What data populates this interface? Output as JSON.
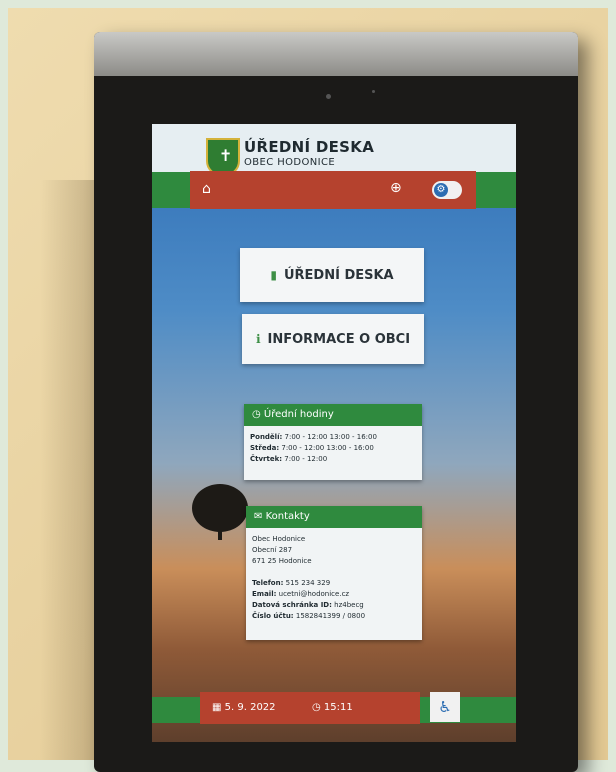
{
  "header": {
    "title": "ÚŘEDNÍ DESKA",
    "subtitle": "OBEC HODONICE"
  },
  "nav": {
    "home_icon": "home-icon",
    "zoom_icon": "zoom-icon",
    "settings_icon": "gear-icon"
  },
  "buttons": {
    "uredni_deska": "ÚŘEDNÍ DESKA",
    "informace": "INFORMACE O OBCI"
  },
  "hours": {
    "title": "Úřední hodiny",
    "rows": [
      {
        "day": "Pondělí:",
        "time": "7:00 - 12:00 13:00 - 16:00"
      },
      {
        "day": "Středa:",
        "time": "7:00 - 12:00 13:00 - 16:00"
      },
      {
        "day": "Čtvrtek:",
        "time": "7:00 - 12:00"
      }
    ]
  },
  "contacts": {
    "title": "Kontakty",
    "address": [
      "Obec Hodonice",
      "Obecní 287",
      "671 25 Hodonice"
    ],
    "rows": [
      {
        "label": "Telefon:",
        "value": "515 234 329"
      },
      {
        "label": "Email:",
        "value": "ucetni@hodonice.cz"
      },
      {
        "label": "Datová schránka ID:",
        "value": "hz4becg"
      },
      {
        "label": "Číslo účtu:",
        "value": "1582841399 / 0800"
      }
    ]
  },
  "footer": {
    "date": "5. 9. 2022",
    "time": "15:11",
    "accessibility_icon": "wheelchair-icon"
  },
  "colors": {
    "brand_red": "#b5422e",
    "brand_green": "#2f8a3e"
  }
}
